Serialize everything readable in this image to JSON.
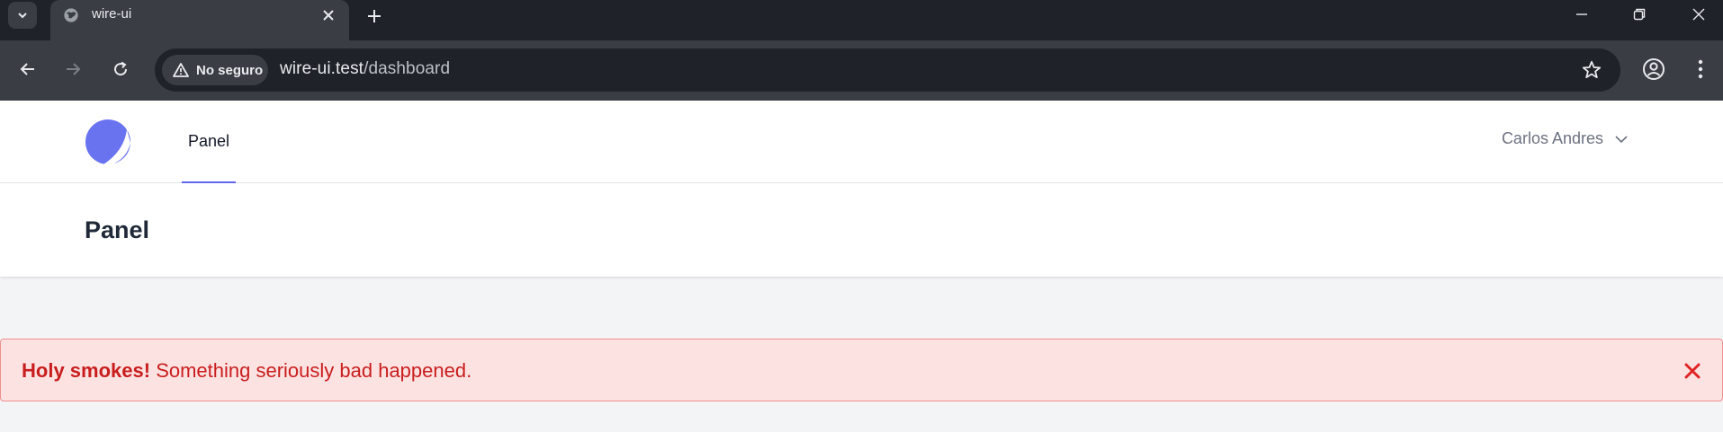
{
  "browser": {
    "tab": {
      "title": "wire-ui",
      "favicon": "globe-icon"
    },
    "omnibox": {
      "security_label": "No seguro",
      "url_host": "wire-ui.test",
      "url_path": "/dashboard"
    }
  },
  "app": {
    "nav": {
      "link_label": "Panel"
    },
    "user": {
      "name": "Carlos Andres"
    },
    "header": {
      "title": "Panel"
    },
    "alert": {
      "title": "Holy smokes!",
      "message": "Something seriously bad happened."
    }
  },
  "colors": {
    "accent": "#6366f1",
    "alert_bg": "#fde2e2",
    "alert_text": "#c81e1e"
  }
}
